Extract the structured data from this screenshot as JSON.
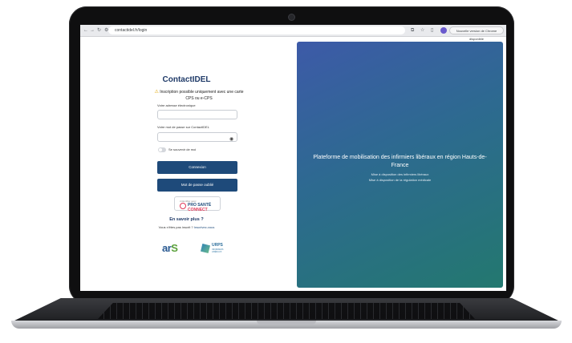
{
  "browser": {
    "url": "contactidel.fr/login",
    "update_label": "Nouvelle version de Chrome disponible"
  },
  "login": {
    "title": "ContactIDEL",
    "notice": "Inscription possible uniquement avec une carte CPS ou e-CPS",
    "email_label": "Votre adresse électronique",
    "email_value": "",
    "password_label": "Votre mot de passe sur ContactIDEL",
    "password_value": "",
    "remember_label": "Se souvenir de moi",
    "login_button": "Connexion",
    "forgot_button": "Mot de passe oublié",
    "prosante": {
      "caption": "s'identifier avec",
      "brand_part1": "PRO SANTÉ",
      "brand_part2": "CONNECT"
    },
    "more_title": "En savoir plus ?",
    "more_text": "Vous n'êtes pas inscrit ?",
    "more_link": "Inscrivez-vous"
  },
  "logos": {
    "ars_main": "ar",
    "ars_s": "S",
    "urps_title": "URPS",
    "urps_sub": "INFIRMIERS LIBÉRAUX"
  },
  "panel": {
    "title": "Plateforme de mobilisation des infirmiers libéraux en région Hauts-de-France",
    "line1": "Mise à disposition des infirmiers libéraux",
    "line2": "Mise à disposition de la régulation médicale"
  },
  "icons": [
    "back-icon",
    "forward-icon",
    "reload-icon",
    "site-settings-icon",
    "open-in-app-icon",
    "star-icon",
    "sidepanel-icon",
    "warning-icon",
    "eye-icon"
  ]
}
